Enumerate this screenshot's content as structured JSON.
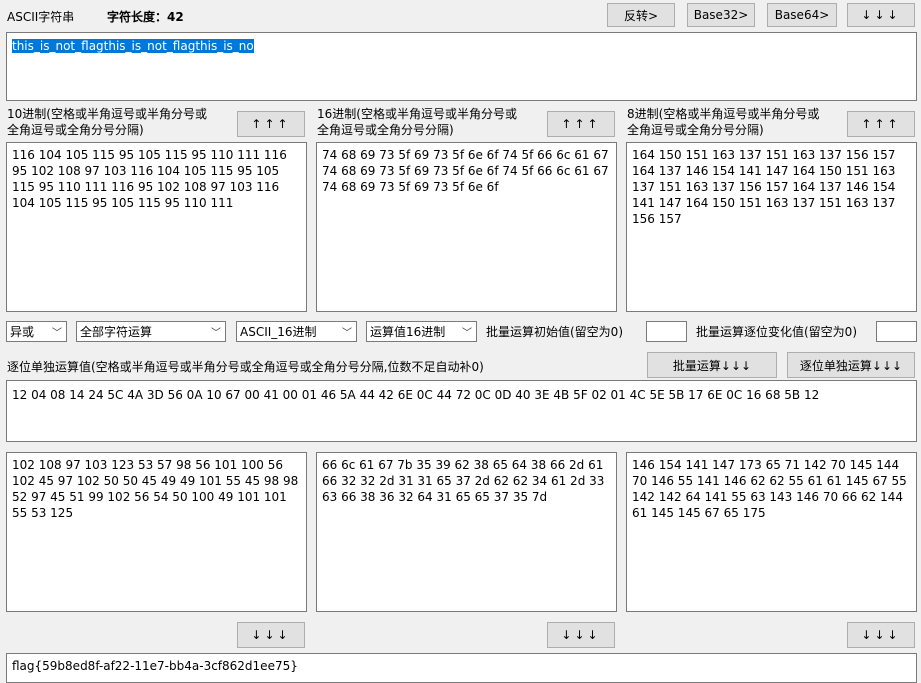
{
  "header": {
    "ascii_label": "ASCII字符串",
    "length_label": "字符长度：42"
  },
  "top_buttons": {
    "reverse": "反转>",
    "base32": "Base32>",
    "base64": "Base64>",
    "down_arrows": "↓↓↓"
  },
  "ascii_input": {
    "value": "this_is_not_flagthis_is_not_flagthis_is_no"
  },
  "panels_top": {
    "dec_label": "10进制(空格或半角逗号或半角分号或全角逗号或全角分号分隔)",
    "hex_label": "16进制(空格或半角逗号或半角分号或全角逗号或全角分号分隔)",
    "oct_label": "8进制(空格或半角逗号或半角分号或全角逗号或全角分号分隔)",
    "up_arrows": "↑↑↑",
    "dec_value": "116 104 105 115 95 105 115 95 110 111 116 95 102 108 97 103 116 104 105 115 95 105 115 95 110 111 116 95 102 108 97 103 116 104 105 115 95 105 115 95 110 111",
    "hex_value": "74 68 69 73 5f 69 73 5f 6e 6f 74 5f 66 6c 61 67 74 68 69 73 5f 69 73 5f 6e 6f 74 5f 66 6c 61 67 74 68 69 73 5f 69 73 5f 6e 6f",
    "oct_value": "164 150 151 163 137 151 163 137 156 157 164 137 146 154 141 147 164 150 151 163 137 151 163 137 156 157 164 137 146 154 141 147 164 150 151 163 137 151 163 137 156 157"
  },
  "controls": {
    "op_select": "异或",
    "scope_select": "全部字符运算",
    "encoding_select": "ASCII_16进制",
    "result_select": "运算值16进制",
    "batch_init_label": "批量运算初始值(留空为0)",
    "batch_step_label": "批量运算逐位变化值(留空为0)",
    "per_bit_label": "逐位单独运算值(空格或半角逗号或半角分号或全角逗号或全角分号分隔,位数不足自动补0)",
    "batch_button": "批量运算↓↓↓",
    "per_bit_button": "逐位单独运算↓↓↓"
  },
  "key_input": {
    "value": "12 04 08 14 24 5C 4A 3D 56 0A 10 67 00 41 00 01 46 5A 44 42 6E 0C 44 72 0C 0D 40 3E 4B 5F 02 01 4C 5E 5B 17 6E 0C 16 68 5B 12"
  },
  "panels_bottom": {
    "dec_value": "102 108 97 103 123 53 57 98 56 101 100 56 102 45 97 102 50 50 45 49 49 101 55 45 98 98 52 97 45 51 99 102 56 54 50 100 49 101 101 55 53 125",
    "hex_value": "66 6c 61 67 7b 35 39 62 38 65 64 38 66 2d 61 66 32 32 2d 31 31 65 37 2d 62 62 34 61 2d 33 63 66 38 36 32 64 31 65 65 37 35 7d",
    "oct_value": "146 154 141 147 173 65 71 142 70 145 144 70 146 55 141 146 62 62 55 61 61 145 67 55 142 142 64 141 55 63 143 146 70 66 62 144 61 145 145 67 65 175",
    "down_arrows": "↓↓↓"
  },
  "result": {
    "value": "flag{59b8ed8f-af22-11e7-bb4a-3cf862d1ee75}"
  }
}
